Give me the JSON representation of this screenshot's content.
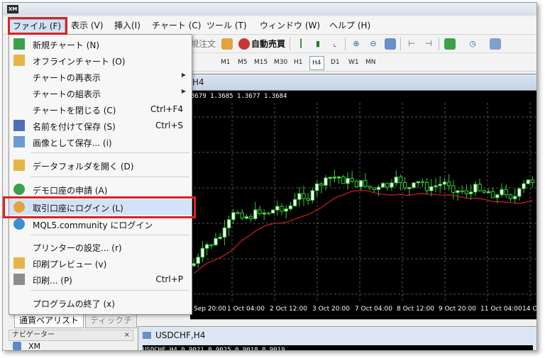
{
  "menubar": {
    "items": [
      "ファイル (F)",
      "表示 (V)",
      "挿入(I)",
      "チャート (C)",
      "ツール (T)",
      "ウィンドウ (W)",
      "ヘルプ (H)"
    ]
  },
  "toolbar": {
    "new_order_partial": "規注文",
    "auto_trade": "自動売買",
    "timeframes": [
      "M1",
      "M5",
      "M15",
      "M30",
      "H1",
      "H4",
      "D1",
      "W1",
      "MN"
    ],
    "active_timeframe": "H4"
  },
  "file_menu": {
    "items": [
      {
        "label": "新規チャート (N)",
        "shortcut": "",
        "icon": "new-chart-icon",
        "submenu": false
      },
      {
        "label": "オフラインチャート (O)",
        "shortcut": "",
        "icon": "open-folder-icon",
        "submenu": false
      },
      {
        "label": "チャートの再表示",
        "shortcut": "",
        "icon": "",
        "submenu": true
      },
      {
        "label": "チャートの組表示",
        "shortcut": "",
        "icon": "",
        "submenu": true
      },
      {
        "label": "チャートを閉じる (C)",
        "shortcut": "Ctrl+F4",
        "icon": "",
        "submenu": false
      },
      {
        "label": "名前を付けて保存 (S)",
        "shortcut": "Ctrl+S",
        "icon": "save-icon",
        "submenu": false
      },
      {
        "label": "画像として保存... (i)",
        "shortcut": "",
        "icon": "save-image-icon",
        "submenu": false
      },
      {
        "label": "データフォルダを開く (D)",
        "shortcut": "",
        "icon": "folder-icon",
        "submenu": false
      },
      {
        "label": "デモ口座の申請 (A)",
        "shortcut": "",
        "icon": "demo-account-icon",
        "submenu": false
      },
      {
        "label": "取引口座にログイン (L)",
        "shortcut": "",
        "icon": "login-icon",
        "submenu": false
      },
      {
        "label": "MQL5.community にログイン",
        "shortcut": "",
        "icon": "mql5-icon",
        "submenu": false
      },
      {
        "label": "プリンターの設定... (r)",
        "shortcut": "",
        "icon": "",
        "submenu": false
      },
      {
        "label": "印刷プレビュー (v)",
        "shortcut": "",
        "icon": "print-preview-icon",
        "submenu": false
      },
      {
        "label": "印刷... (P)",
        "shortcut": "Ctrl+P",
        "icon": "print-icon",
        "submenu": false
      },
      {
        "label": "プログラムの終了 (x)",
        "shortcut": "",
        "icon": "",
        "submenu": false
      }
    ]
  },
  "chart_window": {
    "title_suffix": "H4",
    "info_line": "8679 1.3685 1.3677 1.3684",
    "x_labels": [
      "Sep 20:00",
      "1 Oct 04:00",
      "2 Oct 12:00",
      "3 Oct 20:00",
      "7 Oct 04:00",
      "8 Oct 12:00",
      "9 Oct 20:00",
      "11 Oct 04:00",
      "14 Oct"
    ]
  },
  "lower_tabs": [
    "通貨ペアリスト",
    "ティックチ"
  ],
  "navigator": {
    "title": "ナビゲーター",
    "close": "×",
    "item": "XM"
  },
  "chart2": {
    "title": "USDCHF,H4",
    "info_line": "USDCHF,H4  0.9021 0.9025 0.9018 0.9019"
  },
  "colors": {
    "highlight_box": "#e02020",
    "bull_candle": "#33cc33",
    "bear_candle": "#ffffff",
    "ma_line": "#d02020"
  }
}
